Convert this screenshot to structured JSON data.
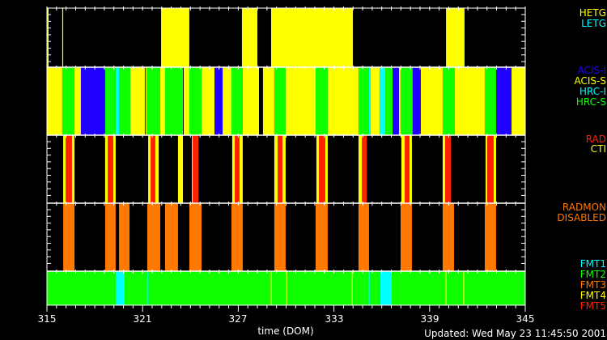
{
  "chart_data": {
    "type": "timeline",
    "xlabel": "time (DOM)",
    "xlim": [
      315,
      345
    ],
    "x_ticks": [
      "315",
      "321",
      "327",
      "333",
      "339",
      "345"
    ],
    "colors": {
      "yellow": "#ffff00",
      "green": "#10ff00",
      "blue": "#2000ff",
      "cyan": "#00ffff",
      "red": "#ff2000",
      "orange": "#ff7800",
      "black": "#000000"
    },
    "panels": [
      {
        "id": "grating",
        "legend": [
          {
            "label": "HETG",
            "color": "yellow"
          },
          {
            "label": "LETG",
            "color": "cyan"
          }
        ],
        "segments": [
          [
            315.0,
            315.1,
            "yellow"
          ],
          [
            315.96,
            316.02,
            "yellow"
          ],
          [
            322.16,
            323.93,
            "yellow"
          ],
          [
            327.23,
            328.2,
            "yellow"
          ],
          [
            329.06,
            334.19,
            "yellow"
          ],
          [
            340.03,
            341.19,
            "yellow"
          ]
        ]
      },
      {
        "id": "instrument",
        "legend": [
          {
            "label": "ACIS-I",
            "color": "blue"
          },
          {
            "label": "ACIS-S",
            "color": "yellow"
          },
          {
            "label": "HRC-I",
            "color": "cyan"
          },
          {
            "label": "HRC-S",
            "color": "green"
          }
        ],
        "segments": [
          [
            315,
            315.96,
            "yellow"
          ],
          [
            315.96,
            316.73,
            "green"
          ],
          [
            316.73,
            317.13,
            "yellow"
          ],
          [
            317.13,
            318.65,
            "blue"
          ],
          [
            318.65,
            319.31,
            "green"
          ],
          [
            319.31,
            319.52,
            "cyan"
          ],
          [
            319.52,
            320.23,
            "green"
          ],
          [
            320.23,
            321.14,
            "yellow"
          ],
          [
            321.14,
            321.19,
            "blue"
          ],
          [
            321.19,
            321.24,
            "yellow"
          ],
          [
            321.24,
            322.11,
            "green"
          ],
          [
            322.11,
            322.41,
            "yellow"
          ],
          [
            322.41,
            323.53,
            "green"
          ],
          [
            323.53,
            323.58,
            "black"
          ],
          [
            323.58,
            323.93,
            "yellow"
          ],
          [
            323.93,
            324.7,
            "green"
          ],
          [
            324.7,
            325.51,
            "yellow"
          ],
          [
            325.51,
            326.02,
            "blue"
          ],
          [
            326.02,
            326.57,
            "yellow"
          ],
          [
            326.57,
            327.28,
            "green"
          ],
          [
            327.28,
            328.3,
            "yellow"
          ],
          [
            328.3,
            328.55,
            "black"
          ],
          [
            328.55,
            329.26,
            "yellow"
          ],
          [
            329.26,
            329.97,
            "green"
          ],
          [
            329.97,
            331.85,
            "yellow"
          ],
          [
            331.85,
            332.61,
            "green"
          ],
          [
            332.61,
            334.54,
            "yellow"
          ],
          [
            334.54,
            335.2,
            "green"
          ],
          [
            335.2,
            335.3,
            "cyan"
          ],
          [
            335.3,
            335.86,
            "yellow"
          ],
          [
            335.86,
            336.22,
            "cyan"
          ],
          [
            336.22,
            336.68,
            "green"
          ],
          [
            336.68,
            337.08,
            "blue"
          ],
          [
            337.08,
            337.18,
            "yellow"
          ],
          [
            337.18,
            337.94,
            "green"
          ],
          [
            337.94,
            338.45,
            "blue"
          ],
          [
            338.45,
            339.82,
            "yellow"
          ],
          [
            339.82,
            340.58,
            "green"
          ],
          [
            340.58,
            342.46,
            "yellow"
          ],
          [
            342.46,
            343.17,
            "green"
          ],
          [
            343.17,
            344.14,
            "blue"
          ],
          [
            344.14,
            345,
            "yellow"
          ]
        ]
      },
      {
        "id": "rad-cti",
        "legend": [
          {
            "label": "RAD",
            "color": "red"
          },
          {
            "label": "CTI",
            "color": "yellow"
          }
        ],
        "segments": [
          [
            316.02,
            316.73,
            "yellow"
          ],
          [
            316.17,
            316.57,
            "red"
          ],
          [
            318.65,
            319.31,
            "yellow"
          ],
          [
            318.81,
            319.16,
            "red"
          ],
          [
            321.35,
            322.01,
            "yellow"
          ],
          [
            321.5,
            321.8,
            "red"
          ],
          [
            323.22,
            323.53,
            "yellow"
          ],
          [
            324.09,
            324.49,
            "yellow"
          ],
          [
            324.14,
            324.49,
            "red"
          ],
          [
            326.62,
            327.28,
            "yellow"
          ],
          [
            326.78,
            327.08,
            "red"
          ],
          [
            329.26,
            329.97,
            "yellow"
          ],
          [
            329.47,
            329.77,
            "red"
          ],
          [
            331.9,
            332.61,
            "yellow"
          ],
          [
            332.06,
            332.46,
            "red"
          ],
          [
            334.54,
            335.05,
            "yellow"
          ],
          [
            334.75,
            335.05,
            "red"
          ],
          [
            337.23,
            337.89,
            "yellow"
          ],
          [
            337.44,
            337.74,
            "red"
          ],
          [
            339.82,
            340.33,
            "yellow"
          ],
          [
            339.97,
            340.33,
            "red"
          ],
          [
            342.51,
            343.17,
            "yellow"
          ],
          [
            342.61,
            343.02,
            "red"
          ]
        ]
      },
      {
        "id": "radmon",
        "legend": [
          {
            "label": "RADMON",
            "color": "orange"
          },
          {
            "label": "DISABLED",
            "color": "orange"
          }
        ],
        "segments": [
          [
            316.02,
            316.73,
            "orange"
          ],
          [
            318.65,
            319.31,
            "orange"
          ],
          [
            319.52,
            320.18,
            "orange"
          ],
          [
            321.29,
            322.11,
            "orange"
          ],
          [
            322.41,
            323.22,
            "orange"
          ],
          [
            323.93,
            324.7,
            "orange"
          ],
          [
            326.57,
            327.28,
            "orange"
          ],
          [
            329.26,
            329.97,
            "orange"
          ],
          [
            331.85,
            332.61,
            "orange"
          ],
          [
            334.54,
            335.2,
            "orange"
          ],
          [
            337.18,
            337.89,
            "orange"
          ],
          [
            339.82,
            340.53,
            "orange"
          ],
          [
            342.46,
            343.17,
            "orange"
          ]
        ]
      },
      {
        "id": "format",
        "legend": [
          {
            "label": "FMT1",
            "color": "cyan"
          },
          {
            "label": "FMT2",
            "color": "green"
          },
          {
            "label": "FMT3",
            "color": "orange"
          },
          {
            "label": "FMT4",
            "color": "yellow"
          },
          {
            "label": "FMT5",
            "color": "red"
          }
        ],
        "segments": [
          [
            315,
            345,
            "green"
          ],
          [
            319.31,
            319.87,
            "cyan"
          ],
          [
            321.27,
            321.33,
            "cyan"
          ],
          [
            329.04,
            329.1,
            "yellow"
          ],
          [
            330.0,
            330.06,
            "yellow"
          ],
          [
            334.12,
            334.18,
            "yellow"
          ],
          [
            335.18,
            335.24,
            "cyan"
          ],
          [
            335.91,
            336.62,
            "cyan"
          ],
          [
            340.0,
            340.06,
            "yellow"
          ],
          [
            341.11,
            341.17,
            "yellow"
          ]
        ]
      }
    ]
  },
  "footer": {
    "updated": "Updated: Wed May 23 11:45:50 2001"
  }
}
